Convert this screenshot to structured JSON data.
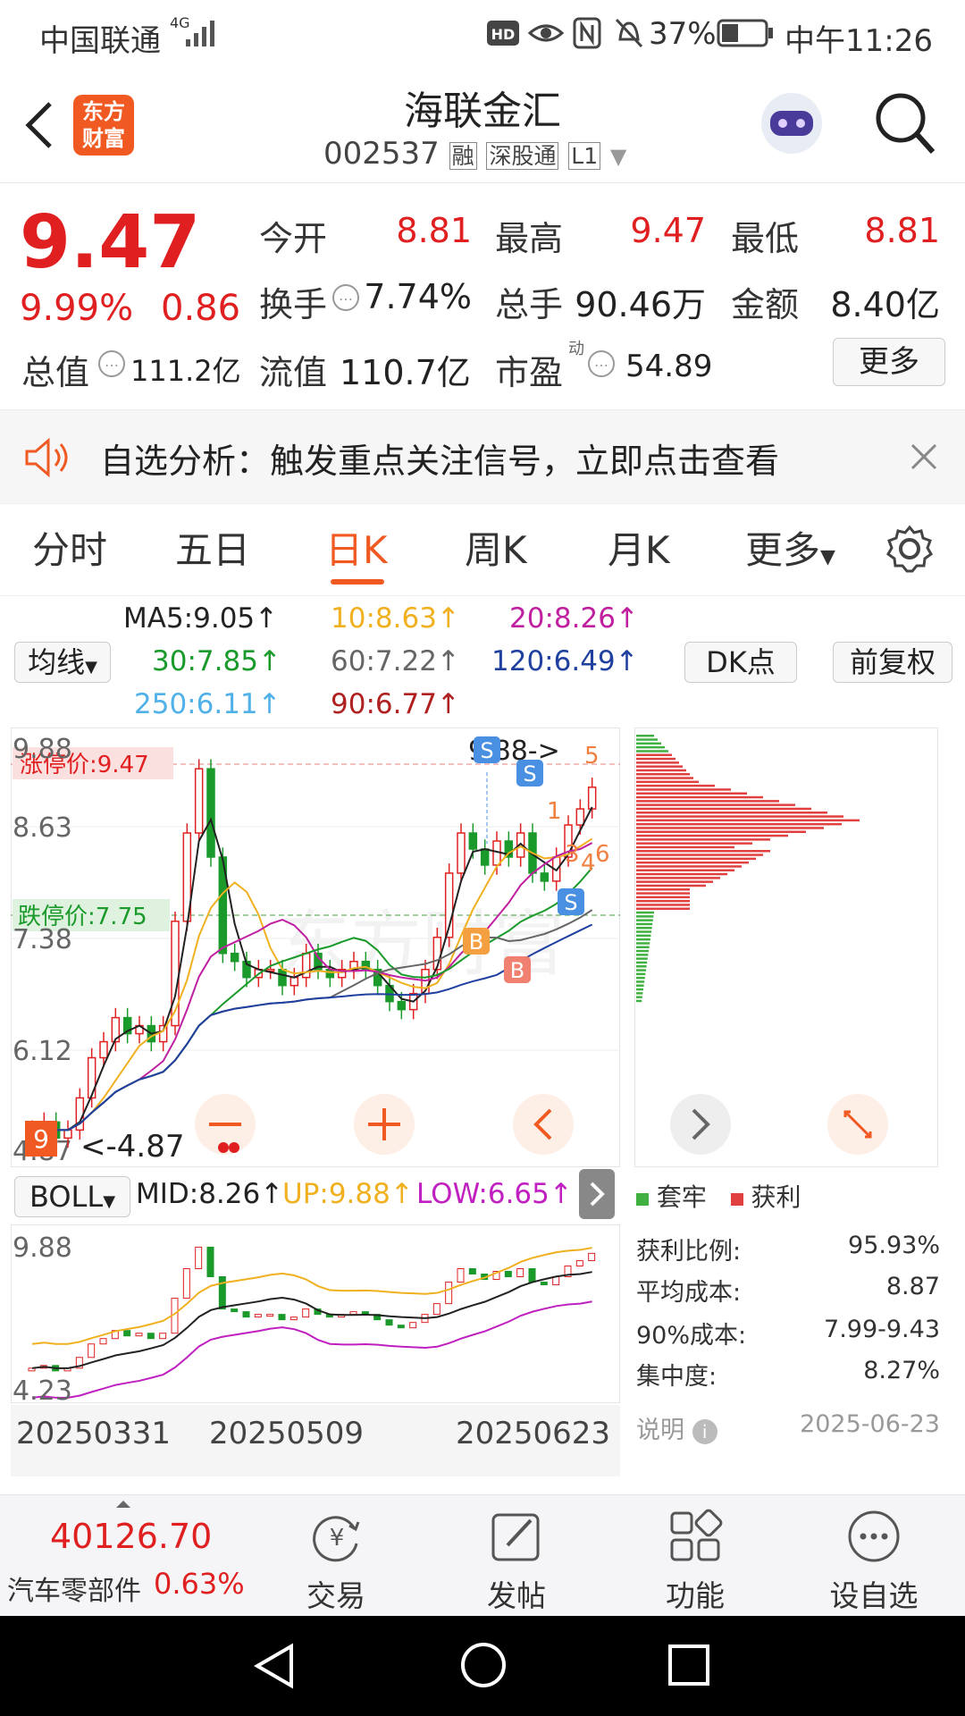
{
  "status_bar": {
    "carrier": "中国联通",
    "network": "4G",
    "battery": "37%",
    "time": "中午11:26"
  },
  "header": {
    "logo_text": "东方\n财富",
    "title": "海联金汇",
    "code": "002537",
    "badges": [
      "融",
      "深股通",
      "L1"
    ]
  },
  "quote": {
    "price": "9.47",
    "change_pct": "9.99%",
    "change_amt": "0.86",
    "fields": [
      {
        "label": "今开",
        "value": "8.81"
      },
      {
        "label": "最高",
        "value": "9.47"
      },
      {
        "label": "最低",
        "value": "8.81"
      },
      {
        "label": "换手",
        "value": "7.74%"
      },
      {
        "label": "总手",
        "value": "90.46万"
      },
      {
        "label": "金额",
        "value": "8.40亿"
      }
    ],
    "total_value_label": "总值",
    "total_value": "111.2亿",
    "float_value_label": "流值",
    "float_value": "110.7亿",
    "pe_label": "市盈",
    "pe_sup": "动",
    "pe": "54.89",
    "more": "更多"
  },
  "notice": {
    "text": "自选分析：触发重点关注信号，立即点击查看"
  },
  "tabs": [
    "分时",
    "五日",
    "日K",
    "周K",
    "月K",
    "更多"
  ],
  "active_tab": "日K",
  "ma": {
    "selector": "均线",
    "values": [
      {
        "text": "MA5:9.05↑",
        "color": "#222222"
      },
      {
        "text": "10:8.63↑",
        "color": "#f0b020"
      },
      {
        "text": "20:8.26↑",
        "color": "#c020a0"
      },
      {
        "text": "30:7.85↑",
        "color": "#1a9a2a"
      },
      {
        "text": "60:7.22↑",
        "color": "#666666"
      },
      {
        "text": "120:6.49↑",
        "color": "#2040a0"
      },
      {
        "text": "250:6.11↑",
        "color": "#50b0e8"
      },
      {
        "text": "90:6.77↑",
        "color": "#b02020"
      }
    ],
    "dk_button": "DK点",
    "adjust_button": "前复权"
  },
  "kchart": {
    "y_labels": [
      "9.88",
      "8.63",
      "7.38",
      "6.12",
      "4.87"
    ],
    "limit_up": "涨停价:9.47",
    "limit_down": "跌停价:7.75",
    "high_marker": "9.88->",
    "low_marker": "<-4.87",
    "markers": [
      "S",
      "S",
      "S",
      "B",
      "B"
    ],
    "numbers": [
      "1",
      "3",
      "4",
      "5",
      "6"
    ],
    "watermark": "东方财富"
  },
  "boll": {
    "selector": "BOLL",
    "mid": "MID:8.26↑",
    "up": "UP:9.88↑",
    "low": "LOW:6.65↑",
    "y_labels": [
      "9.88",
      "4.23"
    ]
  },
  "dates": [
    "20250331",
    "20250509",
    "20250623"
  ],
  "chip": {
    "legend_loss": "套牢",
    "legend_profit": "获利",
    "stats": [
      {
        "label": "获利比例:",
        "value": "95.93%"
      },
      {
        "label": "平均成本:",
        "value": "8.87"
      },
      {
        "label": "90%成本:",
        "value": "7.99-9.43"
      },
      {
        "label": "集中度:",
        "value": "8.27%"
      }
    ],
    "note": "说明",
    "date": "2025-06-23"
  },
  "bottom": {
    "index_value": "40126.70",
    "sector": "汽车零部件",
    "sector_pct": "0.63%",
    "nav": [
      "交易",
      "发帖",
      "功能",
      "设自选"
    ]
  },
  "colors": {
    "up": "#e02020",
    "down": "#1a9a2a",
    "accent": "#f05a22"
  }
}
